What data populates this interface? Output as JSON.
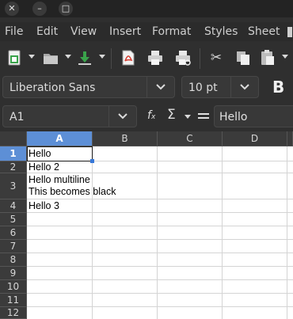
{
  "window": {
    "close_glyph": "✕",
    "minimize_glyph": "–",
    "maximize_glyph": "□"
  },
  "menubar": {
    "items": [
      "File",
      "Edit",
      "View",
      "Insert",
      "Format",
      "Styles",
      "Sheet"
    ]
  },
  "toolbar": {
    "cut_glyph": "✂",
    "bold_label": "B"
  },
  "font": {
    "name": "Liberation Sans",
    "size": "10 pt"
  },
  "formula": {
    "cell_ref": "A1",
    "value": "Hello",
    "fx_label": "f",
    "sum_glyph": "Σ"
  },
  "sheet": {
    "columns": [
      "A",
      "B",
      "C",
      "D"
    ],
    "rows": [
      "1",
      "2",
      "3",
      "4",
      "5",
      "6",
      "7",
      "8",
      "9",
      "10",
      "11",
      "12"
    ],
    "cells": {
      "a1": "Hello",
      "a2": "Hello 2",
      "a3_line1": "Hello multiline",
      "a3_line2": "This becomes black",
      "a4": "Hello 3"
    },
    "selected_cell": "A1"
  },
  "colors": {
    "selection_header": "#5d8fd6",
    "selection_handle": "#3778d8"
  }
}
